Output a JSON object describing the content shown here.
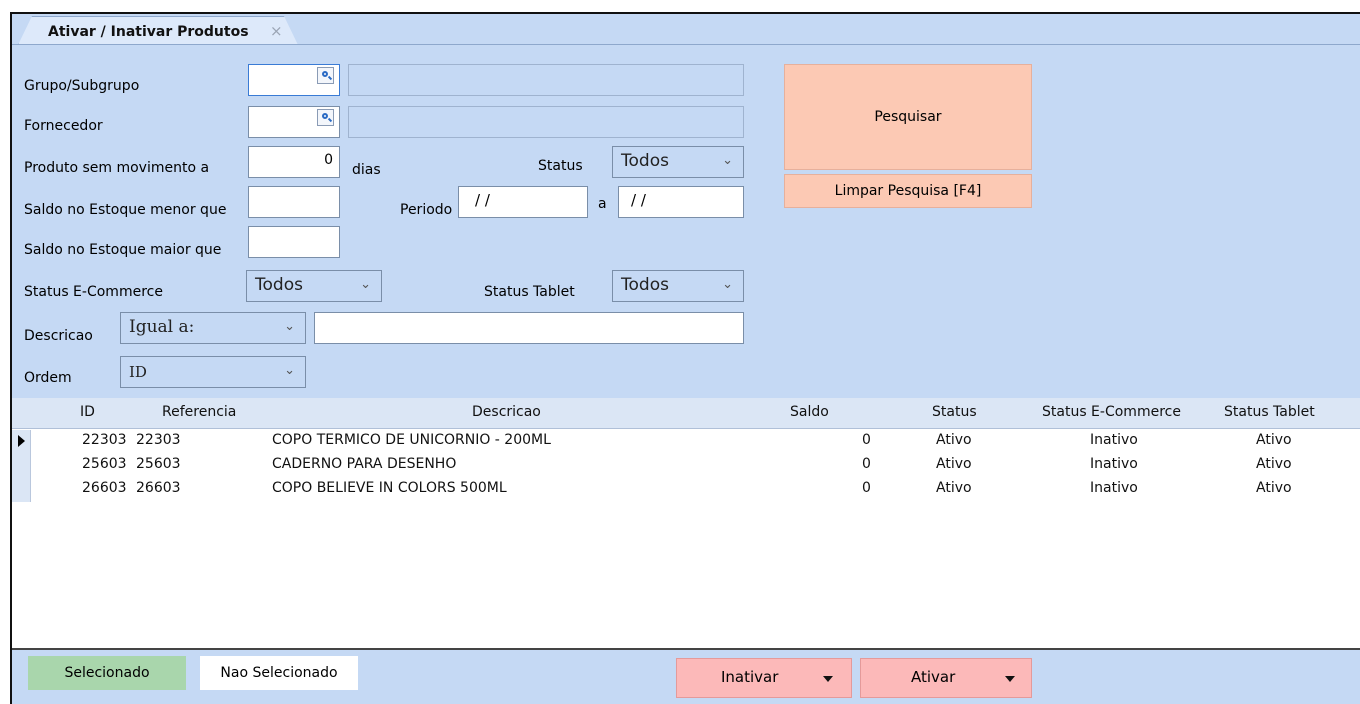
{
  "tab": {
    "title": "Ativar / Inativar Produtos",
    "close": "×"
  },
  "filters": {
    "grupo_label": "Grupo/Subgrupo",
    "fornecedor_label": "Fornecedor",
    "sem_movimento_label": "Produto sem movimento a",
    "sem_movimento_value": "0",
    "dias_label": "dias",
    "status_label": "Status",
    "status_value": "Todos",
    "saldo_menor_label": "Saldo no Estoque menor que",
    "periodo_label": "Periodo",
    "periodo_inicio": "/ /",
    "periodo_a": "a",
    "periodo_fim": "/ /",
    "saldo_maior_label": "Saldo no Estoque maior que",
    "ecommerce_label": "Status E-Commerce",
    "ecommerce_value": "Todos",
    "tablet_label": "Status Tablet",
    "tablet_value": "Todos",
    "descricao_label": "Descricao",
    "descricao_mode": "Igual a:",
    "ordem_label": "Ordem",
    "ordem_value": "ID"
  },
  "buttons": {
    "pesquisar": "Pesquisar",
    "limpar": "Limpar Pesquisa [F4]"
  },
  "grid": {
    "headers": [
      "ID",
      "Referencia",
      "Descricao",
      "Saldo",
      "Status",
      "Status E-Commerce",
      "Status Tablet"
    ],
    "rows": [
      {
        "id": "22303",
        "ref": "22303",
        "desc": "COPO TERMICO DE UNICORNIO - 200ML",
        "saldo": "0",
        "status": "Ativo",
        "ecom": "Inativo",
        "tablet": "Ativo"
      },
      {
        "id": "25603",
        "ref": "25603",
        "desc": "CADERNO PARA DESENHO",
        "saldo": "0",
        "status": "Ativo",
        "ecom": "Inativo",
        "tablet": "Ativo"
      },
      {
        "id": "26603",
        "ref": "26603",
        "desc": "COPO BELIEVE IN COLORS 500ML",
        "saldo": "0",
        "status": "Ativo",
        "ecom": "Inativo",
        "tablet": "Ativo"
      }
    ]
  },
  "footer": {
    "selecionado": "Selecionado",
    "nao_selecionado": "Nao Selecionado",
    "inativar": "Inativar",
    "ativar": "Ativar"
  },
  "colors": {
    "background": "#c5d9f4",
    "search_button": "#fcc9b4",
    "action_button": "#fcb9b9",
    "selected": "#a9d6ac"
  }
}
